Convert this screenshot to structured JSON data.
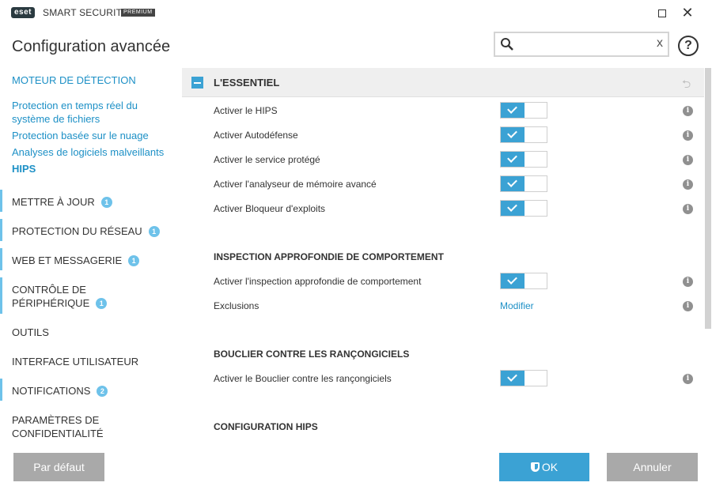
{
  "titlebar": {
    "logo": "eset",
    "product": "SMART SECURITY",
    "edition": "PREMIUM",
    "maximize_icon": "maximize-icon",
    "close_icon": "close-icon"
  },
  "header": {
    "title": "Configuration avancée",
    "search": {
      "value": "",
      "placeholder": "",
      "clear_label": "x"
    },
    "help_label": "?"
  },
  "sidebar": {
    "detection_engine": "MOTEUR DE DÉTECTION",
    "sub_items": [
      {
        "label": "Protection en temps réel du système de fichiers"
      },
      {
        "label": "Protection basée sur le nuage"
      },
      {
        "label": "Analyses de logiciels malveillants"
      },
      {
        "label": "HIPS"
      }
    ],
    "items": [
      {
        "label": "METTRE À JOUR",
        "badge": "1"
      },
      {
        "label": "PROTECTION DU RÉSEAU",
        "badge": "1"
      },
      {
        "label": "WEB ET MESSAGERIE",
        "badge": "1"
      },
      {
        "label": "CONTRÔLE DE PÉRIPHÉRIQUE",
        "badge": "1"
      },
      {
        "label": "OUTILS",
        "badge": ""
      },
      {
        "label": "INTERFACE UTILISATEUR",
        "badge": ""
      },
      {
        "label": "NOTIFICATIONS",
        "badge": "2"
      },
      {
        "label": "PARAMÈTRES DE CONFIDENTIALITÉ",
        "badge": ""
      }
    ]
  },
  "main": {
    "section_title": "L'ESSENTIEL",
    "basic_rows": [
      {
        "label": "Activer le HIPS",
        "enabled": true
      },
      {
        "label": "Activer Autodéfense",
        "enabled": true
      },
      {
        "label": "Activer le service protégé",
        "enabled": true
      },
      {
        "label": "Activer l'analyseur de mémoire avancé",
        "enabled": true
      },
      {
        "label": "Activer Bloqueur d'exploits",
        "enabled": true
      }
    ],
    "deep_inspection": {
      "title": "INSPECTION APPROFONDIE DE COMPORTEMENT",
      "enable_label": "Activer l'inspection approfondie de comportement",
      "exclusions_label": "Exclusions",
      "modify_link": "Modifier"
    },
    "ransomware": {
      "title": "BOUCLIER CONTRE LES RANÇONGICIELS",
      "enable_label": "Activer le Bouclier contre les rançongiciels"
    },
    "hips_config": {
      "title": "CONFIGURATION HIPS"
    },
    "info_glyph": "i"
  },
  "footer": {
    "default_label": "Par défaut",
    "ok_label": "OK",
    "cancel_label": "Annuler"
  },
  "colors": {
    "accent": "#3ba2d4",
    "link": "#1d90c6",
    "badge": "#6ec2ea",
    "button_gray": "#a9a9a9"
  }
}
